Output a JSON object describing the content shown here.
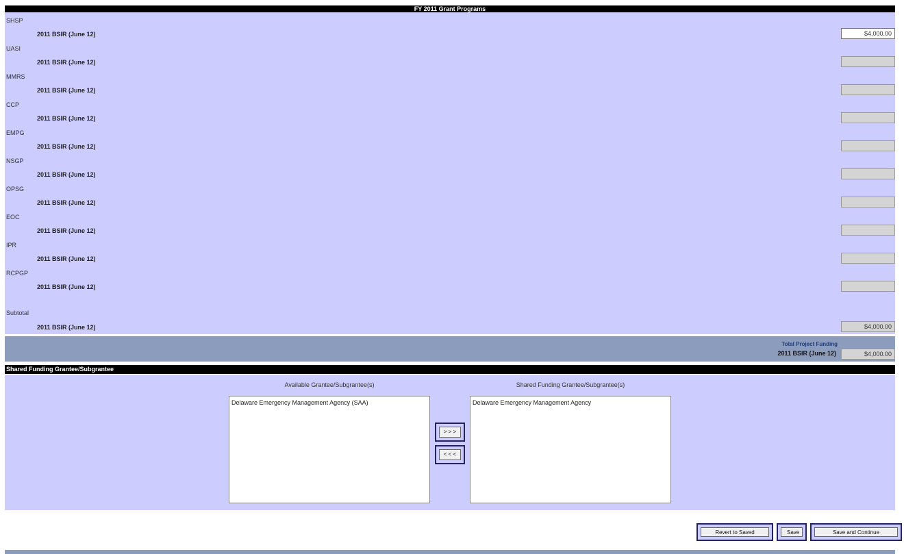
{
  "header": {
    "title": "FY 2011 Grant Programs"
  },
  "programs": [
    {
      "name": "SHSP",
      "row_label": "2011 BSIR (June 12)",
      "amount": "$4,000.00"
    },
    {
      "name": "UASI",
      "row_label": "2011 BSIR (June 12)",
      "amount": ""
    },
    {
      "name": "MMRS",
      "row_label": "2011 BSIR (June 12)",
      "amount": ""
    },
    {
      "name": "CCP",
      "row_label": "2011 BSIR (June 12)",
      "amount": ""
    },
    {
      "name": "EMPG",
      "row_label": "2011 BSIR (June 12)",
      "amount": ""
    },
    {
      "name": "NSGP",
      "row_label": "2011 BSIR (June 12)",
      "amount": ""
    },
    {
      "name": "OPSG",
      "row_label": "2011 BSIR (June 12)",
      "amount": ""
    },
    {
      "name": "EOC",
      "row_label": "2011 BSIR (June 12)",
      "amount": ""
    },
    {
      "name": "IPR",
      "row_label": "2011 BSIR (June 12)",
      "amount": ""
    },
    {
      "name": "RCPGP",
      "row_label": "2011 BSIR (June 12)",
      "amount": ""
    }
  ],
  "subtotal": {
    "label": "Subtotal",
    "row_label": "2011 BSIR (June 12)",
    "amount": "$4,000.00"
  },
  "total": {
    "title": "Total Project Funding",
    "row_label": "2011 BSIR (June 12)",
    "amount": "$4,000.00"
  },
  "shared": {
    "header": "Shared Funding Grantee/Subgrantee",
    "available_title": "Available Grantee/Subgrantee(s)",
    "shared_title": "Shared Funding Grantee/Subgrantee(s)",
    "available_items": [
      "Delaware Emergency Management Agency (SAA)"
    ],
    "shared_items": [
      "Delaware Emergency Management Agency"
    ],
    "add_label": "> > >",
    "remove_label": "< < <"
  },
  "actions": {
    "revert_label": "Revert to Saved",
    "save_label": "Save",
    "save_continue_label": "Save and Continue"
  }
}
